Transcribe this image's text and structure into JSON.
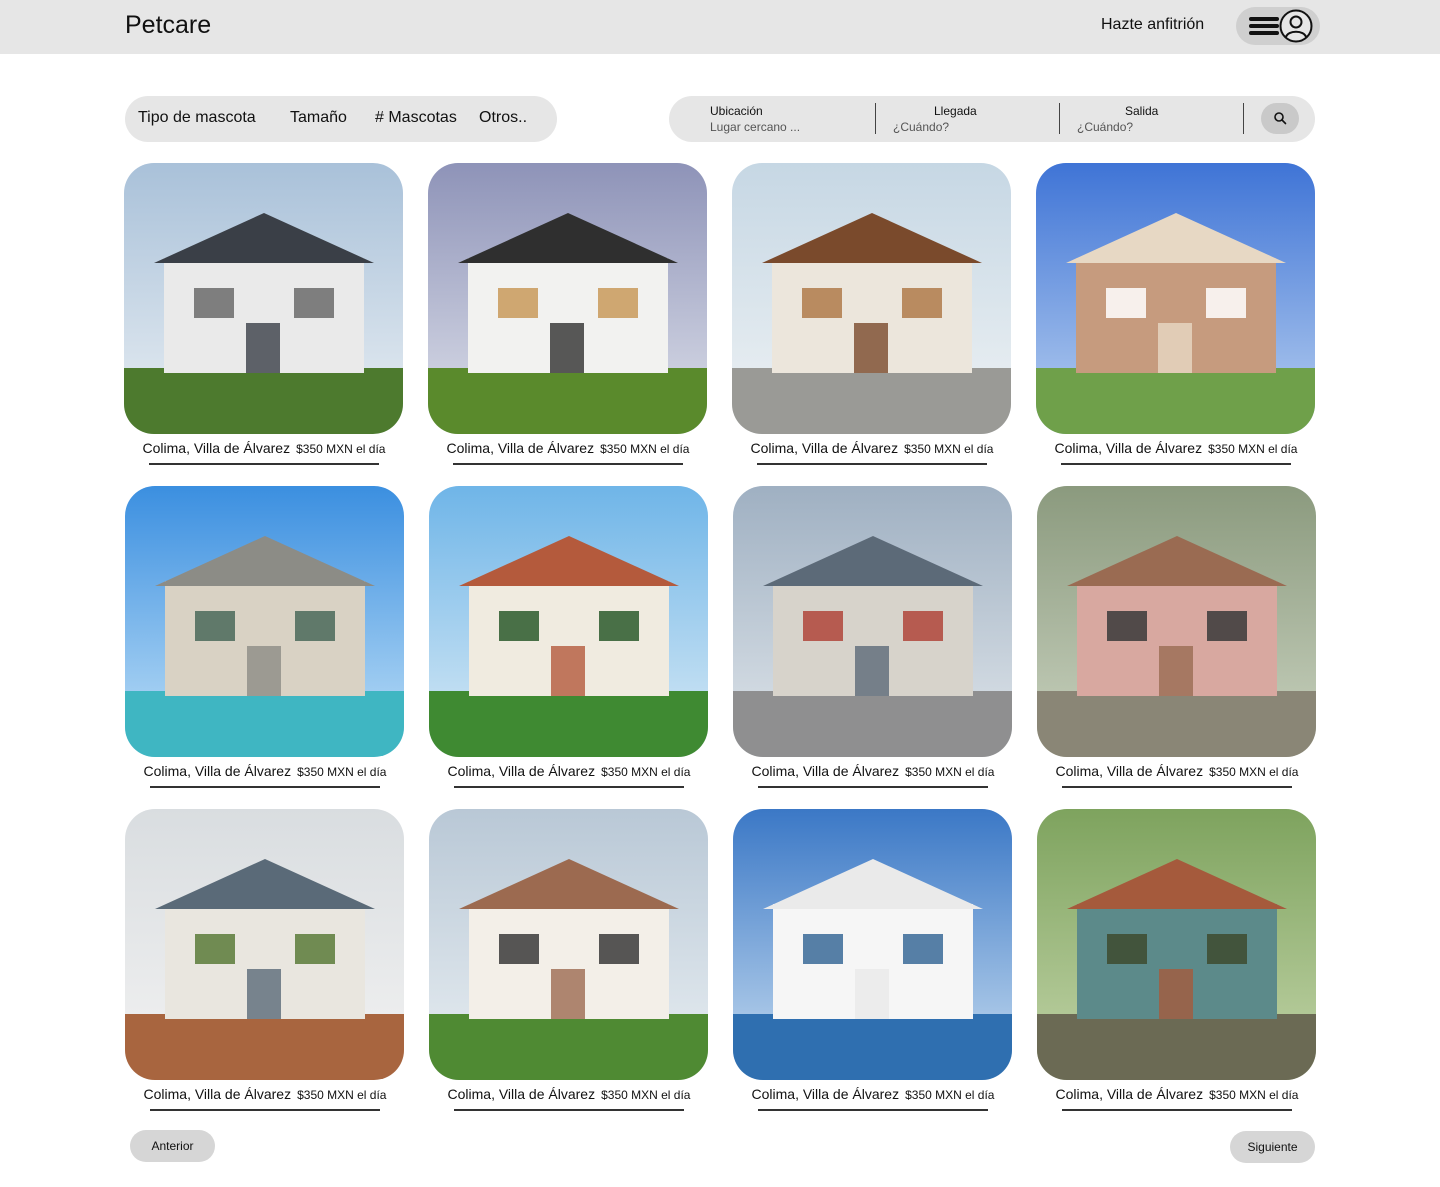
{
  "header": {
    "brand": "Petcare",
    "host_link": "Hazte anfitrión"
  },
  "filters": [
    "Tipo de mascota",
    "Tamaño",
    "# Mascotas",
    "Otros.."
  ],
  "search": {
    "location_label": "Ubicación",
    "location_placeholder": "Lugar cercano ...",
    "arrival_label": "Llegada",
    "arrival_placeholder": "¿Cuándo?",
    "departure_label": "Salida",
    "departure_placeholder": "¿Cuándo?"
  },
  "listings": [
    {
      "location": "Colima, Villa de Álvarez",
      "price": "$350 MXN el día"
    },
    {
      "location": "Colima, Villa de Álvarez",
      "price": "$350 MXN el día"
    },
    {
      "location": "Colima, Villa de Álvarez",
      "price": "$350 MXN el día"
    },
    {
      "location": "Colima, Villa de Álvarez",
      "price": "$350 MXN el día"
    },
    {
      "location": "Colima, Villa de Álvarez",
      "price": "$350 MXN el día"
    },
    {
      "location": "Colima, Villa de Álvarez",
      "price": "$350 MXN el día"
    },
    {
      "location": "Colima, Villa de Álvarez",
      "price": "$350 MXN el día"
    },
    {
      "location": "Colima, Villa de Álvarez",
      "price": "$350 MXN el día"
    },
    {
      "location": "Colima, Villa de Álvarez",
      "price": "$350 MXN el día"
    },
    {
      "location": "Colima, Villa de Álvarez",
      "price": "$350 MXN el día"
    },
    {
      "location": "Colima, Villa de Álvarez",
      "price": "$350 MXN el día"
    },
    {
      "location": "Colima, Villa de Álvarez",
      "price": "$350 MXN el día"
    }
  ],
  "pagination": {
    "previous": "Anterior",
    "next": "Siguiente"
  }
}
